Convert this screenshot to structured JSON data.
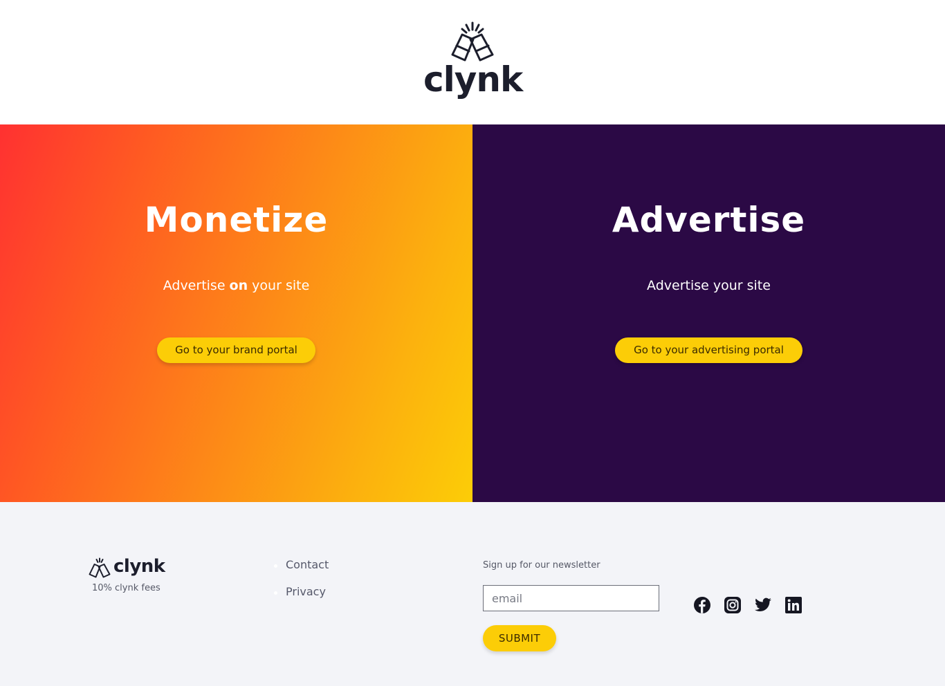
{
  "brand": {
    "name": "clynk"
  },
  "hero": {
    "left": {
      "title": "Monetize",
      "subtitle_before": "Advertise ",
      "subtitle_bold": "on",
      "subtitle_after": " your site",
      "button_label": "Go to your brand portal"
    },
    "right": {
      "title": "Advertise",
      "subtitle": "Advertise your site",
      "button_label": "Go to your advertising portal"
    }
  },
  "footer": {
    "brand_name": "clynk",
    "tagline": "10% clynk fees",
    "links": [
      {
        "label": "Contact"
      },
      {
        "label": "Privacy"
      }
    ],
    "newsletter": {
      "label": "Sign up for our newsletter",
      "email_placeholder": "email",
      "email_value": "",
      "submit_label": "SUBMIT"
    },
    "social_icons": [
      "facebook-icon",
      "instagram-icon",
      "twitter-icon",
      "linkedin-icon"
    ]
  },
  "colors": {
    "accent_yellow": "#fccd07",
    "gradient_start": "#ff3131",
    "gradient_end": "#fccd07",
    "dark_purple": "#2b0945",
    "footer_bg": "#f3f4f8",
    "logo_dark": "#1c1e2c"
  }
}
